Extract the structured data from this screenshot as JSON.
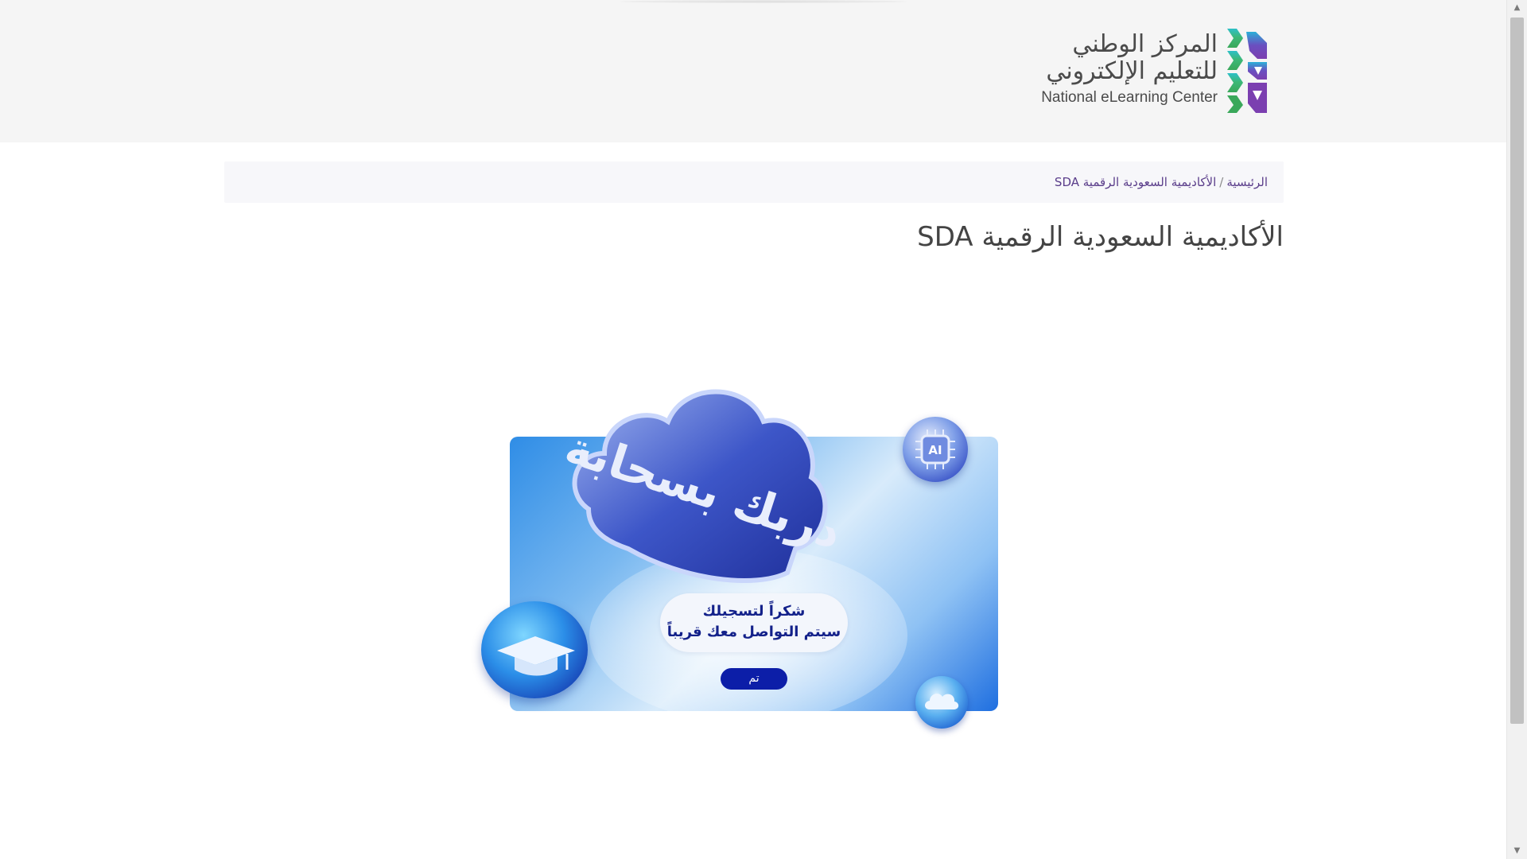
{
  "header": {
    "logo": {
      "line1_ar": "المركز الوطني",
      "line2_ar": "للتعليم الإلكتروني",
      "name_en": "National eLearning Center"
    }
  },
  "breadcrumb": {
    "home_label": "الرئيسية",
    "separator": "/",
    "current_label": "الأكاديمية السعودية الرقمية SDA"
  },
  "page": {
    "title": "الأكاديمية السعودية الرقمية SDA"
  },
  "banner": {
    "cloud_text_ar": "دربك بسحابة",
    "ai_badge": "AI",
    "thanks_line1": "شكراً لتسجيلك",
    "thanks_line2": "سيتم التواصل معك قريباً",
    "done_label": "تم"
  },
  "colors": {
    "brand_purple": "#5a3d8a",
    "banner_blue": "#1f6fe0",
    "button_navy": "#0c1ea8",
    "thanks_text": "#13218a"
  },
  "icons": {
    "logo_mark": "nelc-logo-icon",
    "graduation": "graduation-cap-icon",
    "ai_chip": "ai-chip-icon",
    "cloud": "cloud-icon"
  }
}
